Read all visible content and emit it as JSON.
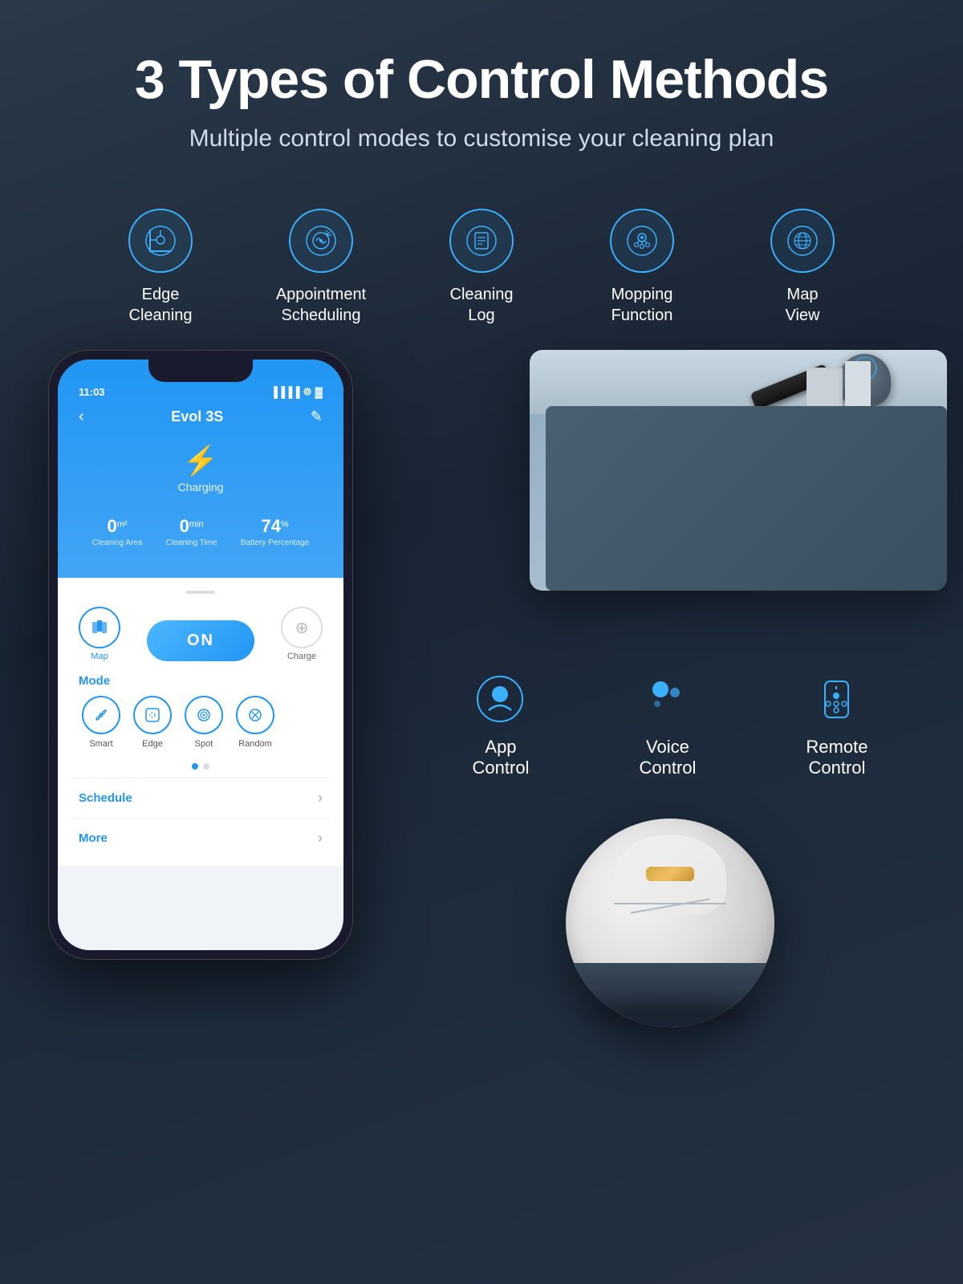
{
  "header": {
    "main_title": "3 Types of Control Methods",
    "subtitle": "Multiple control modes to customise your cleaning plan"
  },
  "features": [
    {
      "id": "edge-cleaning",
      "label": "Edge\nCleaning",
      "label_line1": "Edge",
      "label_line2": "Cleaning"
    },
    {
      "id": "appointment-scheduling",
      "label": "Appointment\nScheduling",
      "label_line1": "Appointment",
      "label_line2": "Scheduling"
    },
    {
      "id": "cleaning-log",
      "label": "Cleaning\nLog",
      "label_line1": "Cleaning",
      "label_line2": "Log"
    },
    {
      "id": "mopping-function",
      "label": "Mopping\nFunction",
      "label_line1": "Mopping",
      "label_line2": "Function"
    },
    {
      "id": "map-view",
      "label": "Map\nView",
      "label_line1": "Map",
      "label_line2": "View"
    }
  ],
  "phone": {
    "time": "11:03",
    "device_name": "Evol 3S",
    "status": "Charging",
    "cleaning_area_value": "0",
    "cleaning_area_unit": "m²",
    "cleaning_area_label": "Cleaning Area",
    "cleaning_time_value": "0",
    "cleaning_time_unit": "min",
    "cleaning_time_label": "Cleaning Time",
    "battery_value": "74",
    "battery_unit": "%",
    "battery_label": "Battery Percentage",
    "on_button": "ON",
    "map_label": "Map",
    "charge_label": "Charge",
    "mode_section_title": "Mode",
    "modes": [
      {
        "id": "smart",
        "label": "Smart"
      },
      {
        "id": "edge",
        "label": "Edge"
      },
      {
        "id": "spot",
        "label": "Spot"
      },
      {
        "id": "random",
        "label": "Random"
      }
    ],
    "schedule_label": "Schedule",
    "more_label": "More"
  },
  "control_methods": [
    {
      "id": "app-control",
      "label_line1": "App",
      "label_line2": "Control"
    },
    {
      "id": "voice-control",
      "label_line1": "Voice",
      "label_line2": "Control"
    },
    {
      "id": "remote-control",
      "label_line1": "Remote",
      "label_line2": "Control"
    }
  ],
  "colors": {
    "accent_blue": "#2196f3",
    "icon_blue": "#3ab0ff",
    "bg_dark": "#1e2d3e",
    "text_white": "#ffffff"
  }
}
